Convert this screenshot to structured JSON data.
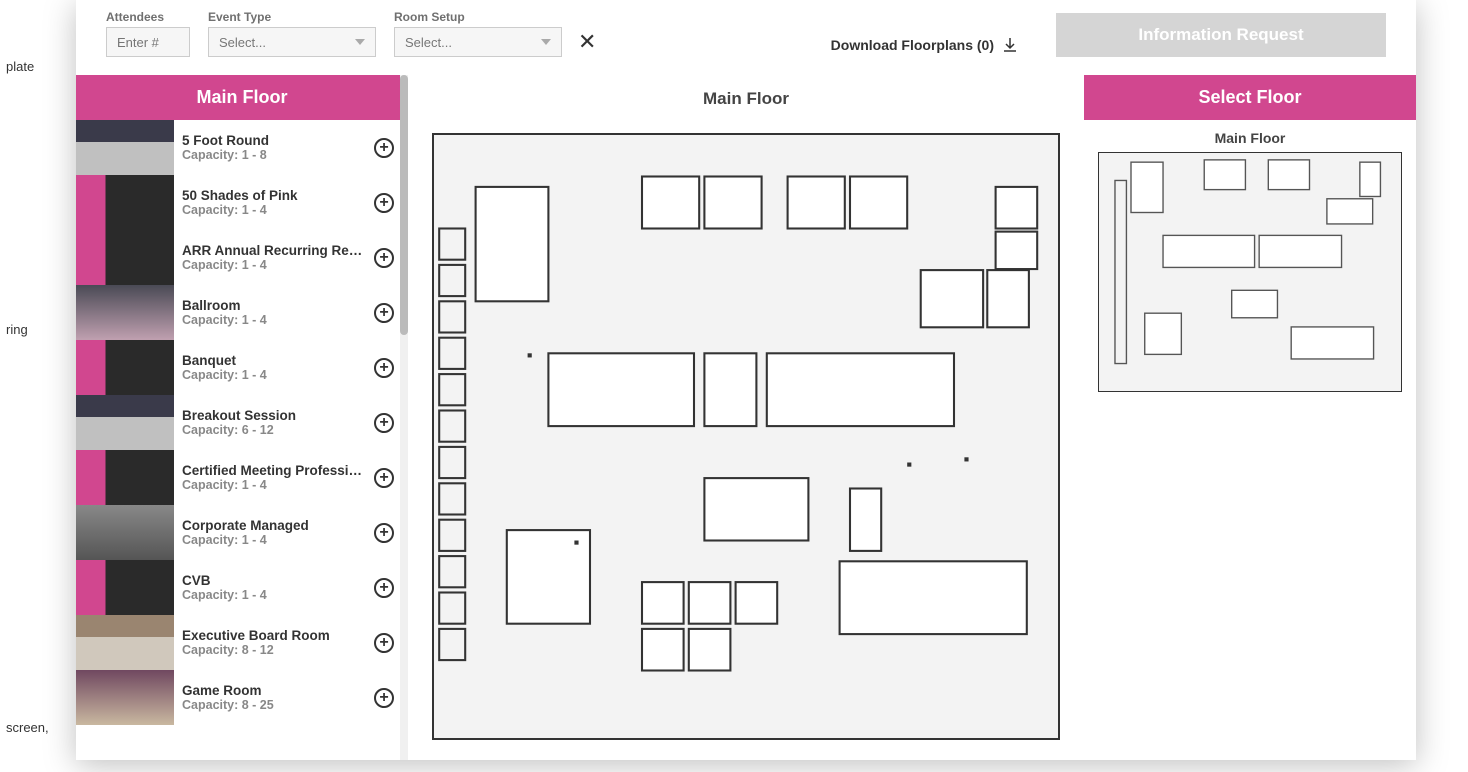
{
  "filters": {
    "attendees_label": "Attendees",
    "attendees_placeholder": "Enter #",
    "event_type_label": "Event Type",
    "event_type_value": "Select...",
    "room_setup_label": "Room Setup",
    "room_setup_value": "Select..."
  },
  "download_label": "Download Floorplans (0)",
  "info_request_label": "Information Request",
  "sidebar": {
    "header": "Main Floor",
    "capacity_prefix": "Capacity: ",
    "rooms": [
      {
        "name": "5 Foot Round",
        "capacity": "1 - 8",
        "thumb": "th-a"
      },
      {
        "name": "50 Shades of Pink",
        "capacity": "1 - 4",
        "thumb": "th-b"
      },
      {
        "name": "ARR Annual Recurring Revenue",
        "capacity": "1 - 4",
        "thumb": "th-b"
      },
      {
        "name": "Ballroom",
        "capacity": "1 - 4",
        "thumb": "th-c"
      },
      {
        "name": "Banquet",
        "capacity": "1 - 4",
        "thumb": "th-b"
      },
      {
        "name": "Breakout Session",
        "capacity": "6 - 12",
        "thumb": "th-a"
      },
      {
        "name": "Certified Meeting Professional",
        "capacity": "1 - 4",
        "thumb": "th-b"
      },
      {
        "name": "Corporate Managed",
        "capacity": "1 - 4",
        "thumb": "th-d"
      },
      {
        "name": "CVB",
        "capacity": "1 - 4",
        "thumb": "th-b"
      },
      {
        "name": "Executive Board Room",
        "capacity": "8 - 12",
        "thumb": "th-e"
      },
      {
        "name": "Game Room",
        "capacity": "8 - 25",
        "thumb": "th-f"
      }
    ]
  },
  "center": {
    "title": "Main Floor"
  },
  "right": {
    "header": "Select Floor",
    "floor_title": "Main Floor"
  },
  "bg_snippets": [
    "plate",
    "ring",
    "screen,"
  ],
  "colors": {
    "brand": "#d1478f"
  }
}
